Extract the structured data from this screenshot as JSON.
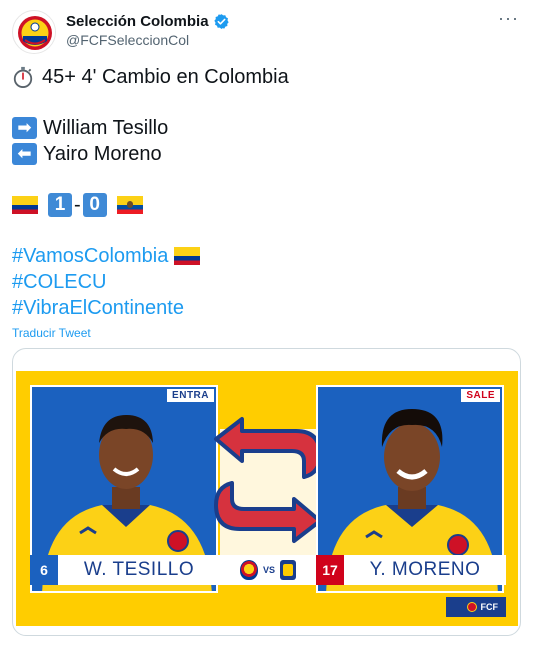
{
  "account": {
    "display_name": "Selección Colombia",
    "handle": "@FCFSeleccionCol",
    "more_icon": "···"
  },
  "tweet": {
    "line1": "45+ 4' Cambio en Colombia",
    "in_player": "William Tesillo",
    "out_player": "Yairo Moreno",
    "score_home": "1",
    "score_separator": "-",
    "score_away": "0",
    "hashtags": [
      "#VamosColombia",
      "#COLECU",
      "#VibraElContinente"
    ],
    "translate_link": "Traducir Tweet"
  },
  "icons": {
    "timer": "stopwatch-icon",
    "in_arrow": "right-arrow-icon",
    "out_arrow": "left-arrow-icon",
    "arrow_right_glyph": "➡",
    "arrow_left_glyph": "⬅"
  },
  "graphic": {
    "left_tag": "ENTRA",
    "right_tag": "SALE",
    "left_number": "6",
    "left_name": "W. TESILLO",
    "right_number": "17",
    "right_name": "Y. MORENO",
    "vs_label": "VS",
    "footer_tag": "FCF"
  },
  "colors": {
    "accent": "#1d9bf0",
    "graphic_yellow": "#ffcd00",
    "panel_blue": "#1b61bf",
    "swap_red": "#d6323e"
  }
}
